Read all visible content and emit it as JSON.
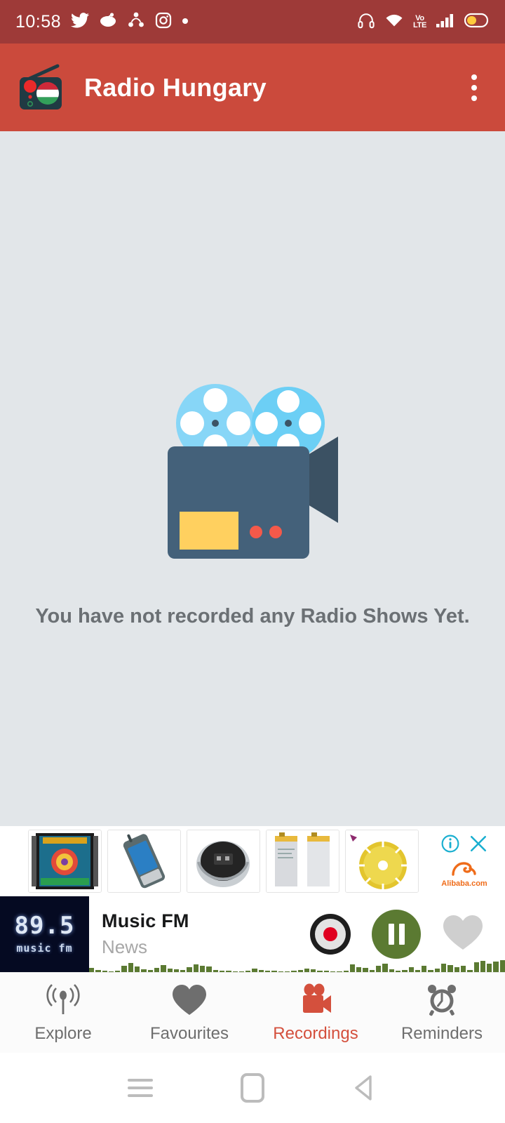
{
  "status_bar": {
    "time": "10:58",
    "left_icons": [
      "twitter-icon",
      "reddit-icon",
      "shareit-icon",
      "instagram-icon",
      "dot-icon"
    ],
    "right_icons": [
      "headphones-icon",
      "wifi-icon",
      "volte-icon",
      "signal-icon",
      "battery-icon"
    ],
    "volte_top": "Vo",
    "volte_bottom": "LTE",
    "background": "#9e3a38"
  },
  "app_bar": {
    "title": "Radio Hungary",
    "logo": "radio-hungary-logo",
    "overflow": "overflow-menu-icon",
    "background": "#cb4a3c",
    "title_color": "#ffffff"
  },
  "main": {
    "illustration": "movie-camera-icon",
    "empty_message": "You have not recorded any Radio Shows Yet.",
    "background": "#e2e6e9",
    "text_color": "#6b7074"
  },
  "ad": {
    "info_icon": "info-icon",
    "close_icon": "close-icon",
    "brand": "Alibaba",
    "brand_suffix": ".com",
    "brand_color": "#ef6c1a",
    "icon_color": "#1aafd0",
    "thumbs": [
      "slot-machine-thumb",
      "rugged-phone-thumb",
      "robot-vacuum-thumb",
      "battery-pack-thumb",
      "saw-blade-thumb"
    ]
  },
  "player": {
    "station": "Music FM",
    "subtitle": "News",
    "art_frequency": "89.5",
    "art_name": "music fm",
    "record_button": "record-button",
    "play_pause_button": "pause-button",
    "favourite_button": "favourite-heart-button",
    "play_color": "#5b7a32",
    "record_dot_color": "#e00020",
    "favourite_color": "#cfcfcf",
    "visualizer": [
      6,
      3,
      2,
      1,
      2,
      9,
      13,
      8,
      4,
      3,
      6,
      10,
      5,
      4,
      3,
      7,
      11,
      9,
      8,
      3,
      2,
      2,
      1,
      1,
      2,
      5,
      3,
      2,
      2,
      1,
      1,
      2,
      3,
      5,
      4,
      2,
      2,
      1,
      1,
      2,
      11,
      7,
      6,
      3,
      9,
      12,
      4,
      2,
      3,
      7,
      3,
      9,
      3,
      5,
      12,
      10,
      7,
      9,
      3,
      14,
      16,
      12,
      15,
      17
    ]
  },
  "bottom_nav": {
    "items": [
      {
        "label": "Explore",
        "icon": "broadcast-icon",
        "active": false
      },
      {
        "label": "Favourites",
        "icon": "heart-icon",
        "active": false
      },
      {
        "label": "Recordings",
        "icon": "video-camera-icon",
        "active": true
      },
      {
        "label": "Reminders",
        "icon": "alarm-clock-icon",
        "active": false
      }
    ],
    "active_color": "#d4503d",
    "inactive_color": "#6e6e6e"
  },
  "system_nav": {
    "recents": "recents-icon",
    "home": "home-icon",
    "back": "back-icon"
  }
}
